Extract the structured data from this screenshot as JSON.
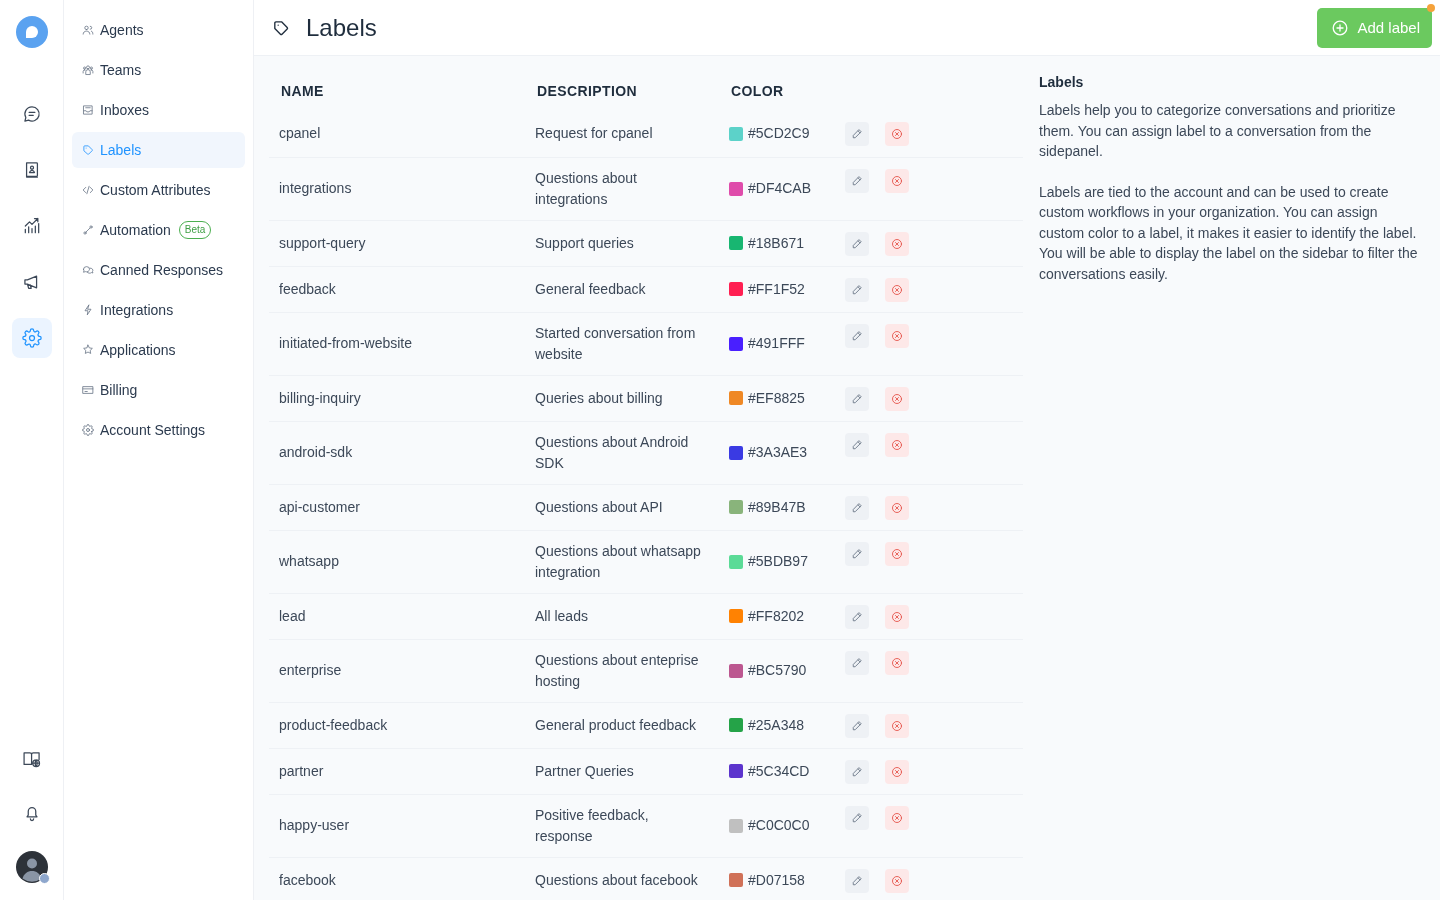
{
  "rail": {
    "top": [
      {
        "kind": "conversations",
        "selected": false
      },
      {
        "kind": "contacts",
        "selected": false
      },
      {
        "kind": "reports",
        "selected": false
      },
      {
        "kind": "campaigns",
        "selected": false
      },
      {
        "kind": "settings",
        "selected": true
      }
    ],
    "bottom": [
      {
        "kind": "help"
      },
      {
        "kind": "notifications"
      }
    ]
  },
  "sidebar": {
    "items": [
      {
        "kind": "agents",
        "label": "Agents",
        "selected": false
      },
      {
        "kind": "teams",
        "label": "Teams",
        "selected": false
      },
      {
        "kind": "inboxes",
        "label": "Inboxes",
        "selected": false
      },
      {
        "kind": "labels",
        "label": "Labels",
        "selected": true
      },
      {
        "kind": "attributes",
        "label": "Custom Attributes",
        "selected": false
      },
      {
        "kind": "automation",
        "label": "Automation",
        "badge": "Beta",
        "selected": false
      },
      {
        "kind": "canned",
        "label": "Canned Responses",
        "selected": false
      },
      {
        "kind": "integrations",
        "label": "Integrations",
        "selected": false
      },
      {
        "kind": "applications",
        "label": "Applications",
        "selected": false
      },
      {
        "kind": "billing",
        "label": "Billing",
        "selected": false
      },
      {
        "kind": "account",
        "label": "Account Settings",
        "selected": false
      }
    ]
  },
  "header": {
    "title": "Labels",
    "add_button": "Add label",
    "alert_dot": true
  },
  "table": {
    "columns": [
      "NAME",
      "DESCRIPTION",
      "COLOR"
    ],
    "rows": [
      {
        "name": "cpanel",
        "description": "Request for cpanel",
        "color": "#5cd2c9",
        "code": "#5CD2C9"
      },
      {
        "name": "integrations",
        "description": "Questions about integrations",
        "color": "#df4cab",
        "code": "#DF4CAB"
      },
      {
        "name": "support-query",
        "description": "Support queries",
        "color": "#18b671",
        "code": "#18B671"
      },
      {
        "name": "feedback",
        "description": "General feedback",
        "color": "#ff1f52",
        "code": "#FF1F52"
      },
      {
        "name": "initiated-from-website",
        "description": "Started conversation from website",
        "color": "#491fff",
        "code": "#491FFF"
      },
      {
        "name": "billing-inquiry",
        "description": "Queries about billing",
        "color": "#ef8825",
        "code": "#EF8825"
      },
      {
        "name": "android-sdk",
        "description": "Questions about Android SDK",
        "color": "#3a3ae3",
        "code": "#3A3AE3"
      },
      {
        "name": "api-customer",
        "description": "Questions about API",
        "color": "#89b47b",
        "code": "#89B47B"
      },
      {
        "name": "whatsapp",
        "description": "Questions about whatsapp integration",
        "color": "#5bdb97",
        "code": "#5BDB97"
      },
      {
        "name": "lead",
        "description": "All leads",
        "color": "#ff8202",
        "code": "#FF8202"
      },
      {
        "name": "enterprise",
        "description": "Questions about enteprise hosting",
        "color": "#bc5790",
        "code": "#BC5790"
      },
      {
        "name": "product-feedback",
        "description": "General product feedback",
        "color": "#25a348",
        "code": "#25A348"
      },
      {
        "name": "partner",
        "description": "Partner Queries",
        "color": "#5c34cd",
        "code": "#5C34CD"
      },
      {
        "name": "happy-user",
        "description": "Positive feedback, response",
        "color": "#c0c0c0",
        "code": "#C0C0C0"
      },
      {
        "name": "facebook",
        "description": "Questions about facebook",
        "color": "#d07158",
        "code": "#D07158"
      }
    ]
  },
  "info": {
    "title": "Labels",
    "paragraphs": [
      "Labels help you to categorize conversations and prioritize them. You can assign label to a conversation from the sidepanel.",
      "Labels are tied to the account and can be used to create custom workflows in your organization. You can assign custom color to a label, it makes it easier to identify the label. You will be able to display the label on the sidebar to filter the conversations easily."
    ]
  }
}
